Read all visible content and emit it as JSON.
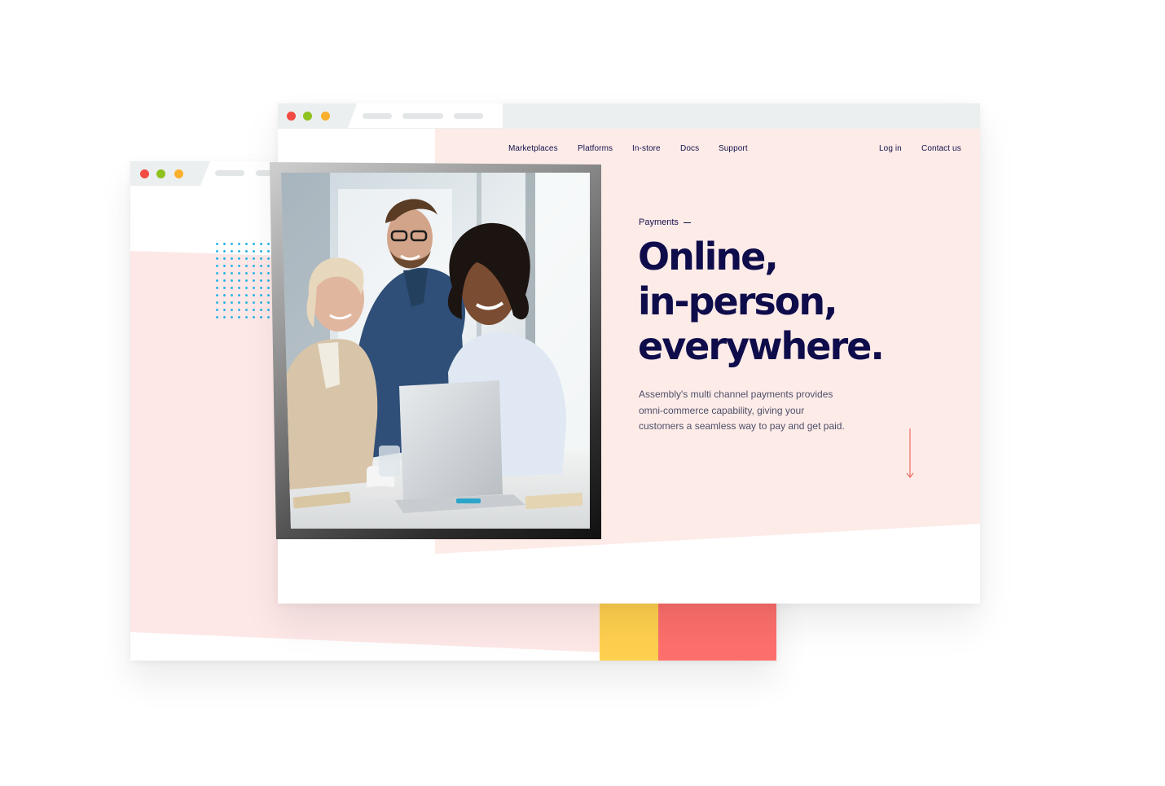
{
  "front_window": {
    "nav": {
      "links": [
        "Marketplaces",
        "Platforms",
        "In-store",
        "Docs",
        "Support"
      ],
      "login": "Log in",
      "contact": "Contact us"
    },
    "hero": {
      "eyebrow": "Payments",
      "headline": [
        "Online,",
        "in-person,",
        "everywhere."
      ],
      "description": [
        "Assembly's multi channel payments provides",
        "omni-commerce capability, giving your",
        "customers a seamless way to pay and get paid."
      ],
      "scroll_icon": "arrow-down-icon",
      "image_subject": "three colleagues smiling at a laptop"
    }
  },
  "colors": {
    "navy": "#0e0c4a",
    "pink": "#fdebe8",
    "coral": "#fd6f6c",
    "yellow": "#ffd04f",
    "dots": "#2cb3e6",
    "window_close": "#f24b43",
    "window_minimize": "#8fc11f",
    "window_maximize": "#fbb02d"
  }
}
